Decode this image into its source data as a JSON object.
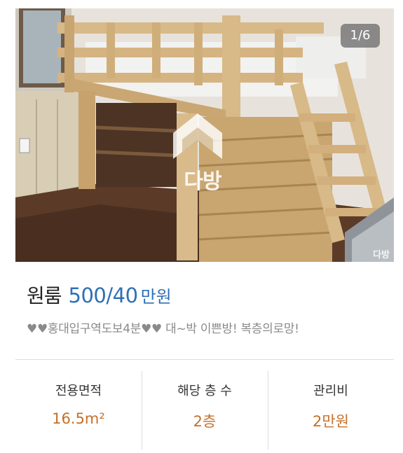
{
  "gallery": {
    "counter": "1/6",
    "watermark": "다방",
    "watermark_corner": "다방"
  },
  "listing": {
    "room_type": "원룸",
    "price": "500/40",
    "price_unit": "만원",
    "description": "♥♥홍대입구역도보4분♥♥ 대~박 이쁜방! 복층의로망!"
  },
  "stats": {
    "area": {
      "label": "전용면적",
      "value": "16.5m²"
    },
    "floor": {
      "label": "해당 층 수",
      "value": "2층"
    },
    "maintenance": {
      "label": "관리비",
      "value": "2만원"
    }
  },
  "colors": {
    "accent": "#2f6fb6",
    "stat_value": "#c4702a",
    "muted": "#8a8a8a"
  },
  "icons": [
    "dabang-logo-icon"
  ]
}
